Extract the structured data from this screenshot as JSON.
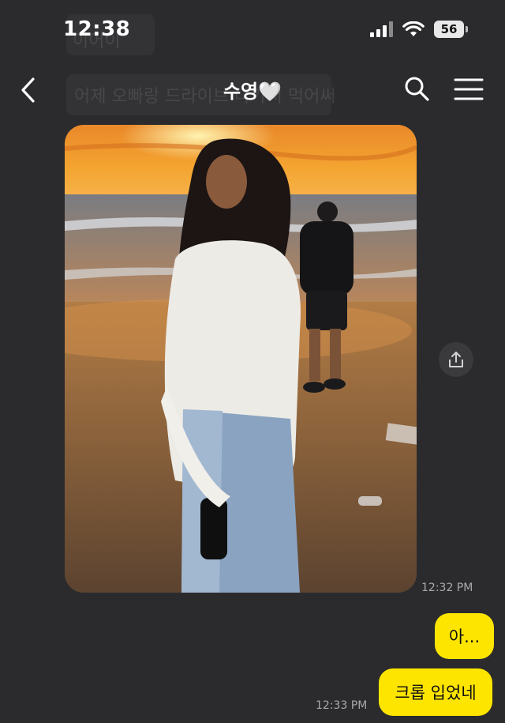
{
  "status_bar": {
    "time": "12:38",
    "battery": "56"
  },
  "background_ghost": {
    "line1": "이어이",
    "line2": "어제 오빠랑 드라이브 나가서 먹어써"
  },
  "header": {
    "title": "수영🤍"
  },
  "messages": [
    {
      "type": "photo",
      "time": "12:32 PM"
    },
    {
      "type": "text",
      "text": "아..."
    },
    {
      "type": "text",
      "text": "크롭 입었네",
      "time": "12:33 PM"
    }
  ],
  "colors": {
    "background": "#2b2b2d",
    "my_bubble": "#fee500",
    "timestamp": "#a9a9ad"
  },
  "icons": [
    "back-icon",
    "search-icon",
    "menu-icon",
    "share-icon"
  ]
}
